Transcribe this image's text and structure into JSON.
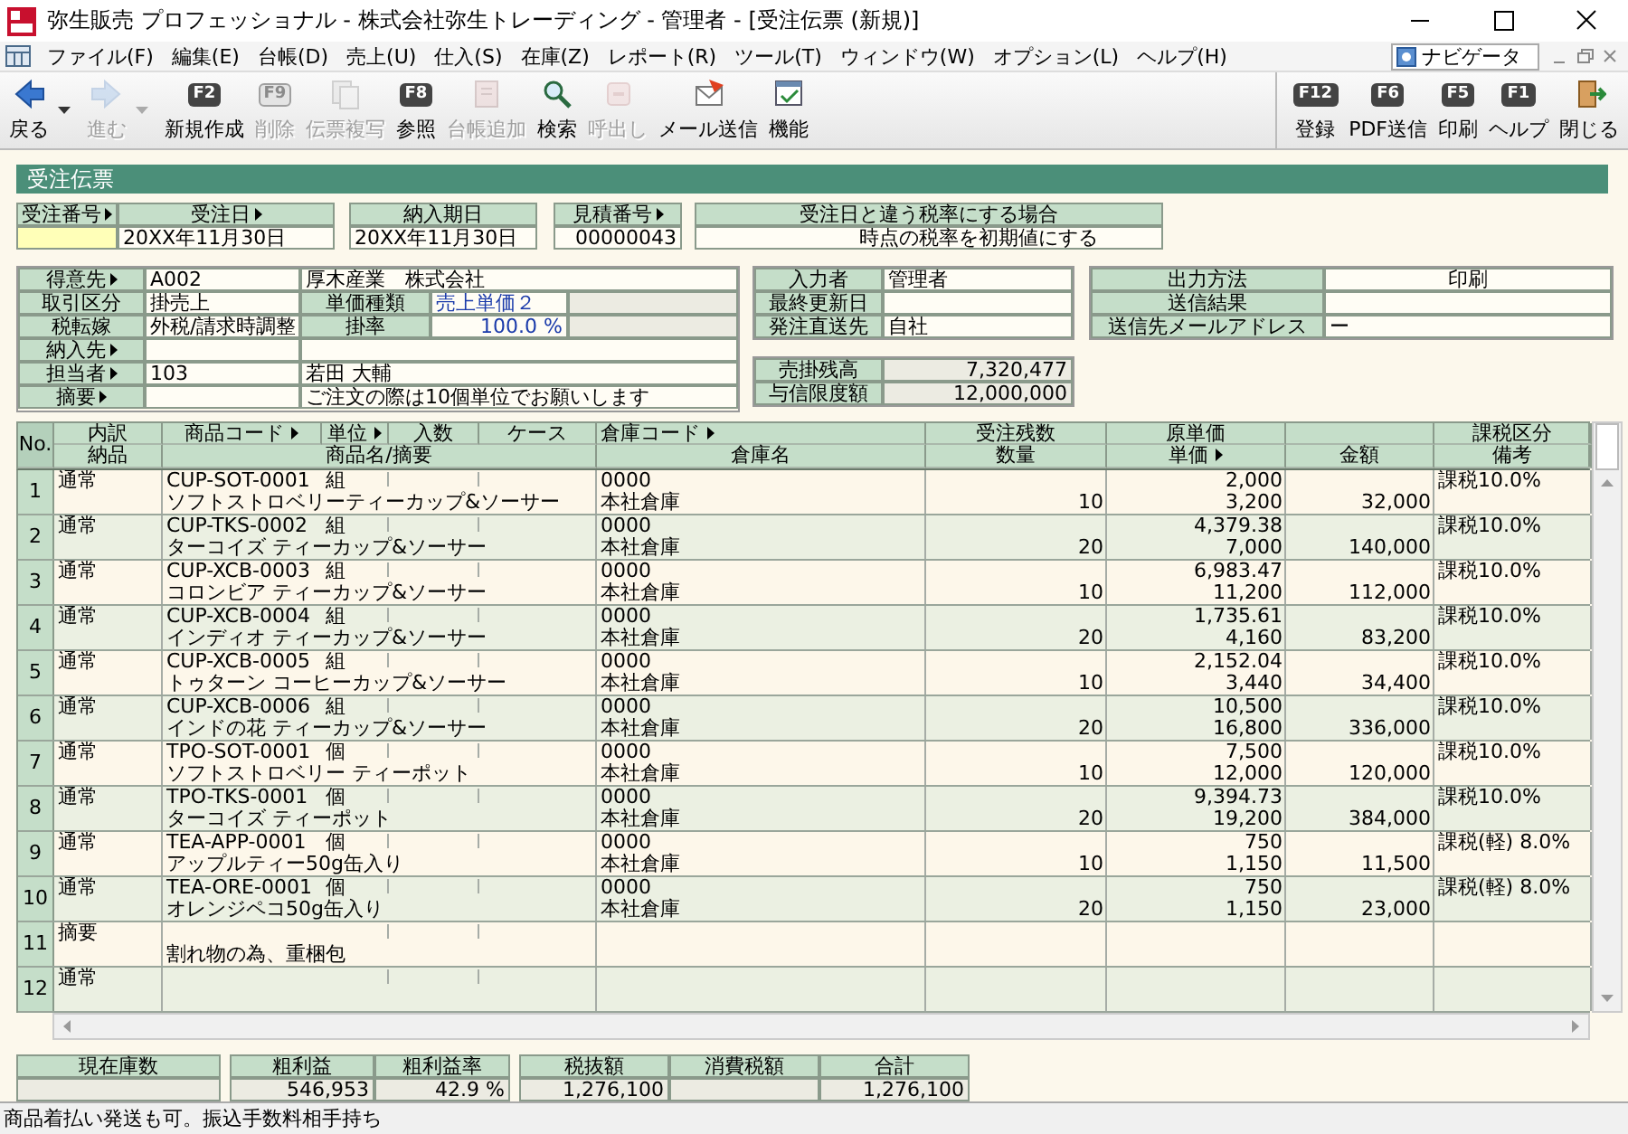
{
  "window": {
    "title": "弥生販売 プロフェッショナル - 株式会社弥生トレーディング - 管理者 - [受注伝票 (新規)]"
  },
  "menu": {
    "items": [
      "ファイル(F)",
      "編集(E)",
      "台帳(D)",
      "売上(U)",
      "仕入(S)",
      "在庫(Z)",
      "レポート(R)",
      "ツール(T)",
      "ウィンドウ(W)",
      "オプション(L)",
      "ヘルプ(H)"
    ],
    "navigator": "ナビゲータ"
  },
  "toolbar": {
    "left": [
      {
        "label": "戻る",
        "kind": "icon",
        "disabled": false,
        "dropdown": true
      },
      {
        "label": "進む",
        "kind": "icon",
        "disabled": true,
        "dropdown": true
      },
      {
        "label": "新規作成",
        "kind": "key",
        "key": "F2",
        "disabled": false,
        "dropdown": false
      },
      {
        "label": "削除",
        "kind": "key",
        "key": "F9",
        "disabled": true,
        "dropdown": false
      },
      {
        "label": "伝票複写",
        "kind": "icon",
        "disabled": true,
        "dropdown": false
      },
      {
        "label": "参照",
        "kind": "key",
        "key": "F8",
        "disabled": false,
        "dropdown": false
      },
      {
        "label": "台帳追加",
        "kind": "icon",
        "disabled": true,
        "dropdown": false
      },
      {
        "label": "検索",
        "kind": "icon",
        "disabled": false,
        "dropdown": false
      },
      {
        "label": "呼出し",
        "kind": "icon",
        "disabled": true,
        "dropdown": false
      },
      {
        "label": "メール送信",
        "kind": "icon",
        "disabled": false,
        "dropdown": false
      },
      {
        "label": "機能",
        "kind": "icon",
        "disabled": false,
        "dropdown": false
      }
    ],
    "right": [
      {
        "label": "登録",
        "kind": "key",
        "key": "F12",
        "disabled": false,
        "dropdown": false
      },
      {
        "label": "PDF送信",
        "kind": "key",
        "key": "F6",
        "disabled": false,
        "dropdown": false
      },
      {
        "label": "印刷",
        "kind": "key",
        "key": "F5",
        "disabled": false,
        "dropdown": false
      },
      {
        "label": "ヘルプ",
        "kind": "key",
        "key": "F1",
        "disabled": false,
        "dropdown": false
      },
      {
        "label": "閉じる",
        "kind": "icon",
        "disabled": false,
        "dropdown": false
      }
    ]
  },
  "form": {
    "title": "受注伝票",
    "header_fields": [
      {
        "label": "受注番号",
        "picker": true,
        "focused": true
      },
      {
        "label": "受注日",
        "picker": true,
        "focused": false,
        "value": "20XX年11月30日"
      },
      {
        "label": "納入期日",
        "picker": false,
        "focused": false,
        "value": "20XX年11月30日"
      },
      {
        "label": "見積番号",
        "picker": true,
        "focused": false,
        "value": "00000043"
      },
      {
        "label": "受注日と違う税率にする場合",
        "picker": false,
        "focused": false,
        "value": "時点の税率を初期値にする"
      }
    ],
    "customer": [
      {
        "label": "得意先",
        "picker": true,
        "code": "A002",
        "name": "厚木産業　株式会社"
      },
      {
        "label": "取引区分",
        "picker": false,
        "code": "掛売上",
        "sub_label": "単価種類",
        "sub_value": "売上単価２",
        "numeric": false
      },
      {
        "label": "税転嫁",
        "picker": false,
        "code": "外税/請求時調整",
        "sub_label": "掛率",
        "sub_value": "100.0 %",
        "numeric": true
      },
      {
        "label": "納入先",
        "picker": true
      },
      {
        "label": "担当者",
        "picker": true,
        "code": "103",
        "name": "若田 大輔"
      },
      {
        "label": "摘要",
        "picker": true,
        "name": "ご注文の際は10個単位でお願いします"
      }
    ],
    "info": [
      {
        "label": "入力者",
        "value": "管理者"
      },
      {
        "label": "最終更新日"
      },
      {
        "label": "発注直送先",
        "value": "自社"
      }
    ],
    "balance": [
      {
        "label": "売掛残高",
        "value": "7,320,477"
      },
      {
        "label": "与信限度額",
        "value": "12,000,000"
      }
    ],
    "output": [
      {
        "label": "出力方法",
        "value": "印刷",
        "centered": true
      },
      {
        "label": "送信結果"
      },
      {
        "label": "送信先メールアドレス",
        "value": "ー",
        "centered": false
      }
    ]
  },
  "table": {
    "number_heading": "No.",
    "columns_top": [
      {
        "label": "内訳",
        "picker": false
      },
      {
        "label": "商品コード",
        "picker": true
      },
      {
        "label": "単位",
        "picker": true
      },
      {
        "label": "入数",
        "picker": false
      },
      {
        "label": "ケース",
        "picker": false
      },
      {
        "label": "倉庫コード",
        "picker": true
      },
      {
        "label": "受注残数",
        "picker": false
      },
      {
        "label": "原単価",
        "picker": false
      },
      {
        "label": "課税区分",
        "picker": false
      }
    ],
    "columns_bottom": [
      {
        "label": "納品",
        "picker": false
      },
      {
        "label": "商品名/摘要",
        "picker": false
      },
      {
        "label": "倉庫名",
        "picker": false
      },
      {
        "label": "数量",
        "picker": false
      },
      {
        "label": "単価",
        "picker": true
      },
      {
        "label": "金額",
        "picker": false
      },
      {
        "label": "備考",
        "picker": false
      }
    ],
    "rows": [
      {
        "no": "1",
        "breakdown": "通常",
        "code": "CUP-SOT-0001",
        "unit": "組",
        "name": "ソフトストロベリーティーカップ&ソーサー",
        "warehouse_code": "0000",
        "warehouse_name": "本社倉庫",
        "quantity": "10",
        "cost": "2,000",
        "price": "3,200",
        "amount": "32,000",
        "tax": "課税10.0%"
      },
      {
        "no": "2",
        "breakdown": "通常",
        "code": "CUP-TKS-0002",
        "unit": "組",
        "name": "ターコイズ ティーカップ&ソーサー",
        "warehouse_code": "0000",
        "warehouse_name": "本社倉庫",
        "quantity": "20",
        "cost": "4,379.38",
        "price": "7,000",
        "amount": "140,000",
        "tax": "課税10.0%"
      },
      {
        "no": "3",
        "breakdown": "通常",
        "code": "CUP-XCB-0003",
        "unit": "組",
        "name": "コロンビア ティーカップ&ソーサー",
        "warehouse_code": "0000",
        "warehouse_name": "本社倉庫",
        "quantity": "10",
        "cost": "6,983.47",
        "price": "11,200",
        "amount": "112,000",
        "tax": "課税10.0%"
      },
      {
        "no": "4",
        "breakdown": "通常",
        "code": "CUP-XCB-0004",
        "unit": "組",
        "name": "インディオ ティーカップ&ソーサー",
        "warehouse_code": "0000",
        "warehouse_name": "本社倉庫",
        "quantity": "20",
        "cost": "1,735.61",
        "price": "4,160",
        "amount": "83,200",
        "tax": "課税10.0%"
      },
      {
        "no": "5",
        "breakdown": "通常",
        "code": "CUP-XCB-0005",
        "unit": "組",
        "name": "トゥターン コーヒーカップ&ソーサー",
        "warehouse_code": "0000",
        "warehouse_name": "本社倉庫",
        "quantity": "10",
        "cost": "2,152.04",
        "price": "3,440",
        "amount": "34,400",
        "tax": "課税10.0%"
      },
      {
        "no": "6",
        "breakdown": "通常",
        "code": "CUP-XCB-0006",
        "unit": "組",
        "name": "インドの花 ティーカップ&ソーサー",
        "warehouse_code": "0000",
        "warehouse_name": "本社倉庫",
        "quantity": "20",
        "cost": "10,500",
        "price": "16,800",
        "amount": "336,000",
        "tax": "課税10.0%"
      },
      {
        "no": "7",
        "breakdown": "通常",
        "code": "TPO-SOT-0001",
        "unit": "個",
        "name": "ソフトストロベリー ティーポット",
        "warehouse_code": "0000",
        "warehouse_name": "本社倉庫",
        "quantity": "10",
        "cost": "7,500",
        "price": "12,000",
        "amount": "120,000",
        "tax": "課税10.0%"
      },
      {
        "no": "8",
        "breakdown": "通常",
        "code": "TPO-TKS-0001",
        "unit": "個",
        "name": "ターコイズ ティーポット",
        "warehouse_code": "0000",
        "warehouse_name": "本社倉庫",
        "quantity": "20",
        "cost": "9,394.73",
        "price": "19,200",
        "amount": "384,000",
        "tax": "課税10.0%"
      },
      {
        "no": "9",
        "breakdown": "通常",
        "code": "TEA-APP-0001",
        "unit": "個",
        "name": "アップルティー50g缶入り",
        "warehouse_code": "0000",
        "warehouse_name": "本社倉庫",
        "quantity": "10",
        "cost": "750",
        "price": "1,150",
        "amount": "11,500",
        "tax": "課税(軽) 8.0%"
      },
      {
        "no": "10",
        "breakdown": "通常",
        "code": "TEA-ORE-0001",
        "unit": "個",
        "name": "オレンジペコ50g缶入り",
        "warehouse_code": "0000",
        "warehouse_name": "本社倉庫",
        "quantity": "20",
        "cost": "750",
        "price": "1,150",
        "amount": "23,000",
        "tax": "課税(軽) 8.0%"
      },
      {
        "no": "11",
        "breakdown": "摘要",
        "name": "割れ物の為、重梱包"
      },
      {
        "no": "12",
        "breakdown": "通常"
      }
    ]
  },
  "footer": [
    {
      "fields": [
        {
          "label": "現在庫数"
        }
      ]
    },
    {
      "fields": [
        {
          "label": "粗利益",
          "value": "546,953"
        },
        {
          "label": "粗利益率",
          "value": "42.9 %"
        }
      ]
    },
    {
      "fields": [
        {
          "label": "税抜額",
          "value": "1,276,100"
        },
        {
          "label": "消費税額"
        },
        {
          "label": "合計",
          "value": "1,276,100"
        }
      ]
    }
  ],
  "status_bar": {
    "text": "商品着払い発送も可。振込手数料相手持ち"
  }
}
